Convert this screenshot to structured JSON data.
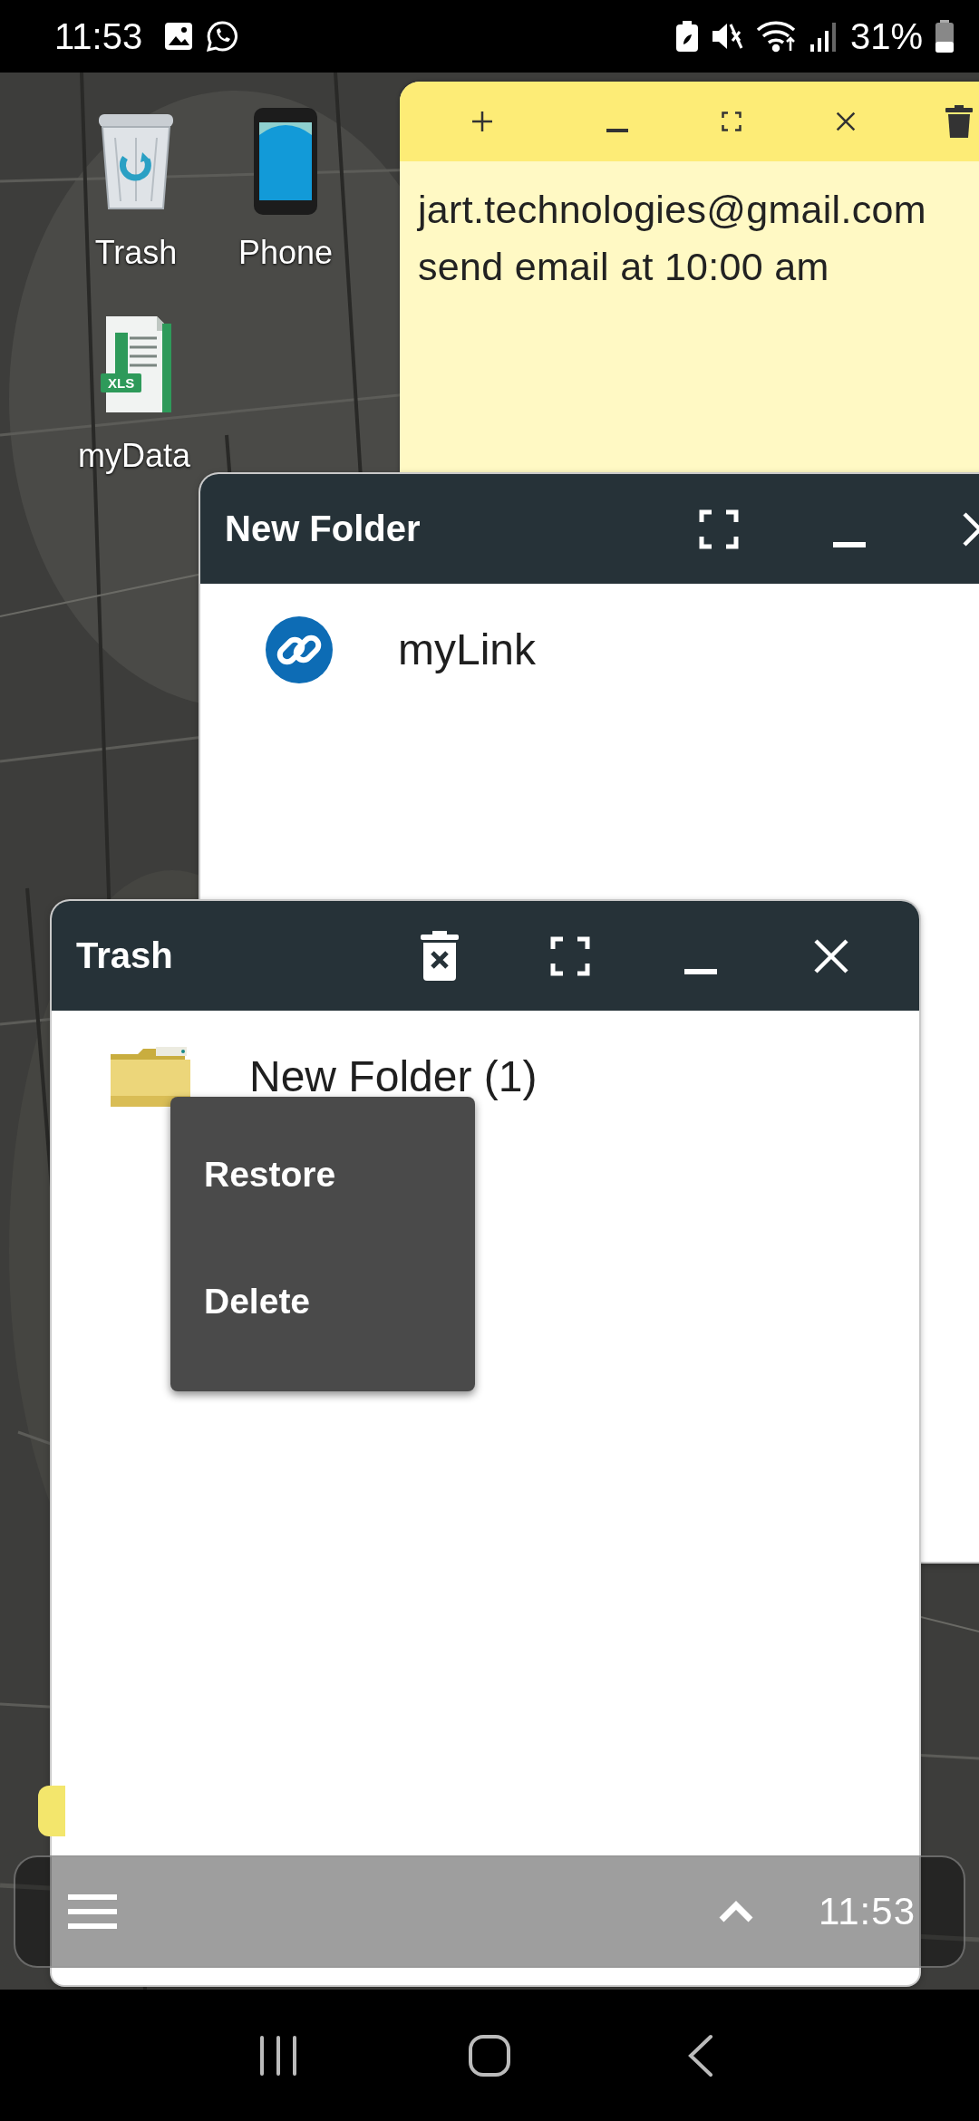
{
  "status_bar": {
    "time": "11:53",
    "battery": "31%"
  },
  "desktop_icons": [
    {
      "label": "Trash",
      "kind": "trash"
    },
    {
      "label": "Phone",
      "kind": "phone"
    },
    {
      "label": "myData",
      "kind": "spreadsheet",
      "badge": "XLS"
    }
  ],
  "note": {
    "lines": [
      "jart.technologies@gmail.com",
      "send email at 10:00 am"
    ]
  },
  "folder_window": {
    "title": "New Folder",
    "items": [
      {
        "label": "myLink",
        "kind": "link"
      }
    ]
  },
  "trash_window": {
    "title": "Trash",
    "items": [
      {
        "label": "New Folder (1)",
        "kind": "folder"
      }
    ]
  },
  "context_menu": {
    "items": [
      "Restore",
      "Delete"
    ]
  },
  "taskbar": {
    "time": "11:53"
  }
}
